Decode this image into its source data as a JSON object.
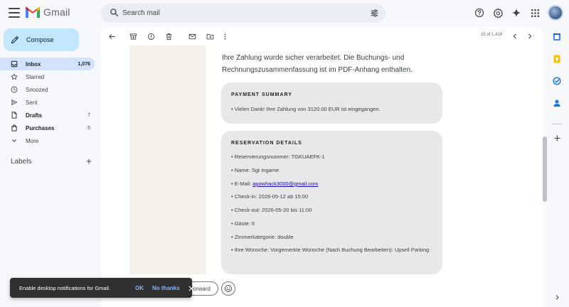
{
  "app": {
    "name": "Gmail"
  },
  "search": {
    "placeholder": "Search mail"
  },
  "compose": {
    "label": "Compose"
  },
  "sidebar": {
    "items": [
      {
        "label": "Inbox",
        "count": "1,076"
      },
      {
        "label": "Starred",
        "count": ""
      },
      {
        "label": "Snoozed",
        "count": ""
      },
      {
        "label": "Sent",
        "count": ""
      },
      {
        "label": "Drafts",
        "count": "7"
      },
      {
        "label": "Purchases",
        "count": "5"
      },
      {
        "label": "More",
        "count": ""
      }
    ],
    "labels_title": "Labels"
  },
  "toolbar": {
    "pager": "15 of 1,419"
  },
  "email": {
    "intro": "Ihre Zahlung wurde sicher verarbeitet. Die Buchungs- und Rechnungszusammenfassung ist im PDF-Anhang enthalten.",
    "payment": {
      "title": "PAYMENT SUMMARY",
      "line": "• Vielen Dank! Ihre Zahlung von 3120.00 EUR ist eingegangen."
    },
    "reservation": {
      "title": "RESERVATION DETAILS",
      "reservation_number": "• Reservierungsnummer: TGKUAEFK-1",
      "name": "• Name: Sgt Ingame",
      "email_prefix": "• E-Mail: ",
      "email_link": "apowhack3000@gmail.com",
      "checkin": "• Check-in: 2026-05-12 ab 15:00",
      "checkout": "• Check-out: 2026-05-20 bis 11:00",
      "guests": "• Gäste: 6",
      "room": "• Zimmerkategorie: double",
      "wishes": "• Ihre Wünsche: Vorgemerkte Wünsche (Nach Buchung Bearbeiten): Upsell Parking"
    }
  },
  "reply": {
    "forward_label": "Forward"
  },
  "snackbar": {
    "text": "Enable desktop notifications for Gmail.",
    "ok": "OK",
    "no_thanks": "No thanks"
  },
  "colors": {
    "accent": "#0b57d0",
    "compose": "#c2e7ff",
    "active_nav": "#d3e3fd",
    "panel": "#e8e8ea",
    "snackbar": "#303030",
    "snackbar_action": "#8ab4f8"
  }
}
